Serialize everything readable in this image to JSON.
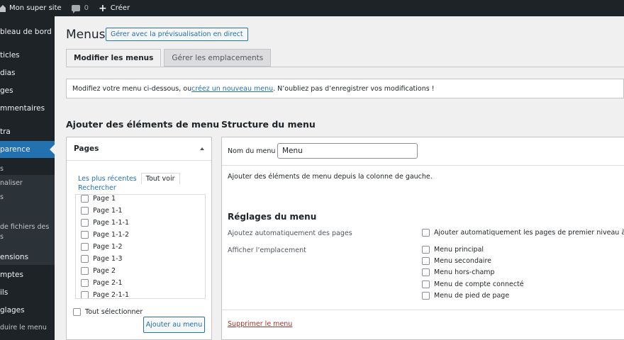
{
  "adminbar": {
    "site_name": "Mon super site",
    "comment_count": "0",
    "new_label": "Créer"
  },
  "sidebar": {
    "items": [
      {
        "label": "bleau de bord"
      },
      {
        "label": "ticles"
      },
      {
        "label": "dias"
      },
      {
        "label": "ges"
      },
      {
        "label": "mmentaires"
      },
      {
        "label": "tra"
      },
      {
        "label": "parence"
      },
      {
        "label": "ensions"
      },
      {
        "label": "mptes"
      },
      {
        "label": "ils"
      },
      {
        "label": "glages"
      },
      {
        "label": "duire le menu"
      }
    ],
    "subitems": [
      {
        "label": "s"
      },
      {
        "label": "naliser"
      },
      {
        "label": "s"
      },
      {
        "label": "de fichiers des"
      },
      {
        "label": "s"
      }
    ],
    "active_color": "#2271b1"
  },
  "header": {
    "title": "Menus",
    "preview_button": "Gérer avec la prévisualisation en direct"
  },
  "tabs": [
    {
      "label": "Modifier les menus",
      "active": true
    },
    {
      "label": "Gérer les emplacements",
      "active": false
    }
  ],
  "notice": {
    "before": "Modifiez votre menu ci-dessous, ou ",
    "link": "créez un nouveau menu",
    "after": ". N’oubliez pas d’enregistrer vos modifications !"
  },
  "left_column": {
    "heading": "Ajouter des éléments de menu",
    "panel_title": "Pages",
    "subtabs": [
      "Les plus récentes",
      "Tout voir"
    ],
    "search_link": "Rechercher",
    "pages": [
      "Page 1",
      "Page 1-1",
      "Page 1-1-1",
      "Page 1-1-2",
      "Page 1-2",
      "Page 1-3",
      "Page 2",
      "Page 2-1",
      "Page 2-1-1"
    ],
    "select_all": "Tout sélectionner",
    "add_button": "Ajouter au menu"
  },
  "right_column": {
    "heading": "Structure du menu",
    "name_label": "Nom du menu",
    "name_value": "Menu",
    "hint": "Ajouter des éléments de menu depuis la colonne de gauche.",
    "settings_title": "Réglages du menu",
    "auto_add_label": "Ajoutez automatiquement des pages",
    "auto_add_option": "Ajouter automatiquement les pages de premier niveau à ce m",
    "location_label": "Afficher l’emplacement",
    "locations": [
      "Menu principal",
      "Menu secondaire",
      "Menu hors-champ",
      "Menu de compte connecté",
      "Menu de pied de page"
    ],
    "delete_link": "Supprimer le menu"
  }
}
